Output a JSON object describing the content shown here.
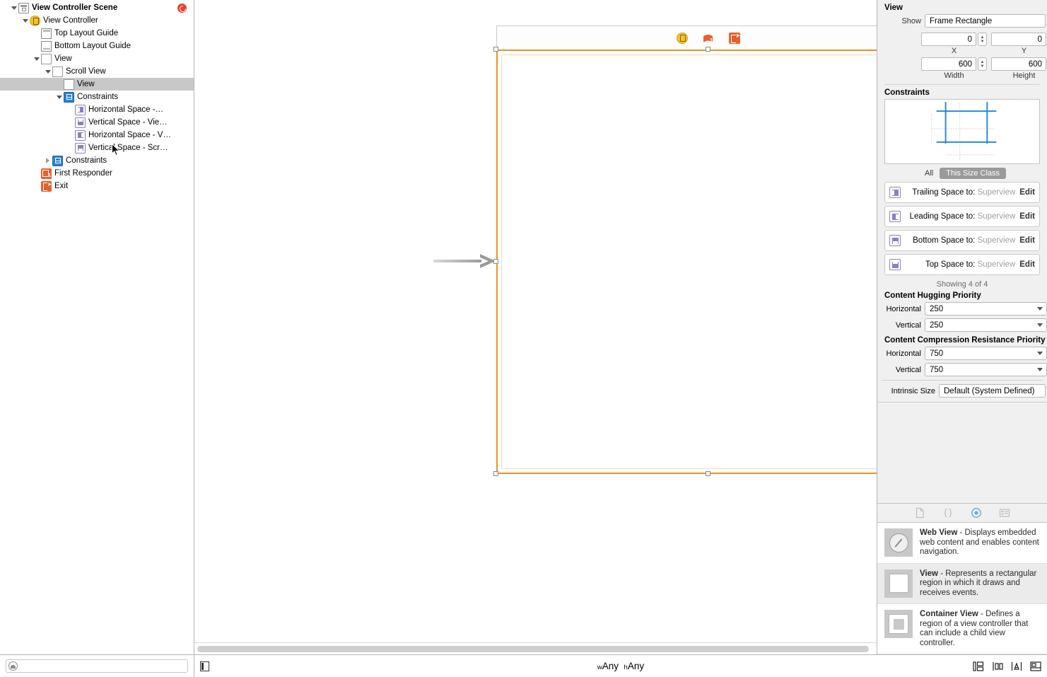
{
  "outline": {
    "rows": [
      {
        "label": "View Controller Scene",
        "indent": 0,
        "disc": "open",
        "icon": "scene-icon",
        "bold": true,
        "selected": false
      },
      {
        "label": "View Controller",
        "indent": 1,
        "disc": "open",
        "icon": "view-controller-icon",
        "bold": false,
        "selected": false
      },
      {
        "label": "Top Layout Guide",
        "indent": 2,
        "disc": "none",
        "icon": "top-layout-guide-icon",
        "bold": false,
        "selected": false
      },
      {
        "label": "Bottom Layout Guide",
        "indent": 2,
        "disc": "none",
        "icon": "bottom-layout-guide-icon",
        "bold": false,
        "selected": false
      },
      {
        "label": "View",
        "indent": 2,
        "disc": "open",
        "icon": "view-icon",
        "bold": false,
        "selected": false
      },
      {
        "label": "Scroll View",
        "indent": 3,
        "disc": "open",
        "icon": "scroll-view-icon",
        "bold": false,
        "selected": false
      },
      {
        "label": "View",
        "indent": 4,
        "disc": "none",
        "icon": "view-icon",
        "bold": false,
        "selected": true
      },
      {
        "label": "Constraints",
        "indent": 4,
        "disc": "open",
        "icon": "constraints-icon",
        "bold": false,
        "selected": false
      },
      {
        "label": "Horizontal Space -…",
        "indent": 5,
        "disc": "none",
        "icon": "constraint-h1-icon",
        "bold": false,
        "selected": false
      },
      {
        "label": "Vertical Space - Vie…",
        "indent": 5,
        "disc": "none",
        "icon": "constraint-v1-icon",
        "bold": false,
        "selected": false
      },
      {
        "label": "Horizontal Space - V…",
        "indent": 5,
        "disc": "none",
        "icon": "constraint-h2-icon",
        "bold": false,
        "selected": false
      },
      {
        "label": "Vertical Space - Scr…",
        "indent": 5,
        "disc": "none",
        "icon": "constraint-v2-icon",
        "bold": false,
        "selected": false
      },
      {
        "label": "Constraints",
        "indent": 3,
        "disc": "closed",
        "icon": "constraints-icon",
        "bold": false,
        "selected": false
      },
      {
        "label": "First Responder",
        "indent": 2,
        "disc": "none",
        "icon": "first-responder-icon",
        "bold": false,
        "selected": false
      },
      {
        "label": "Exit",
        "indent": 2,
        "disc": "none",
        "icon": "exit-icon",
        "bold": false,
        "selected": false
      }
    ],
    "error_badge": "scene-error-badge",
    "filter_placeholder": ""
  },
  "canvas": {
    "scene_bar_icons": [
      "view-controller-icon",
      "first-responder-icon",
      "exit-icon"
    ],
    "selection_color": "#e8952a",
    "entry_arrow": "storyboard-entry-point-arrow"
  },
  "inspector": {
    "title": "View",
    "show_label": "Show",
    "show_value": "Frame Rectangle",
    "frame": {
      "x_label": "X",
      "x_value": "0",
      "y_label": "Y",
      "y_value": "0",
      "width_label": "Width",
      "width_value": "600",
      "height_label": "Height",
      "height_value": "600"
    },
    "constraints_title": "Constraints",
    "scope": {
      "all": "All",
      "this_size_class": "This Size Class",
      "active": "This Size Class"
    },
    "constraint_rows": [
      {
        "label": "Trailing Space to:",
        "target": "Superview",
        "edit": "Edit",
        "icon": "constraint-trailing-icon"
      },
      {
        "label": "Leading Space to:",
        "target": "Superview",
        "edit": "Edit",
        "icon": "constraint-leading-icon"
      },
      {
        "label": "Bottom Space to:",
        "target": "Superview",
        "edit": "Edit",
        "icon": "constraint-bottom-icon"
      },
      {
        "label": "Top Space to:",
        "target": "Superview",
        "edit": "Edit",
        "icon": "constraint-top-icon"
      }
    ],
    "showing": "Showing 4 of 4",
    "hugging": {
      "title": "Content Hugging Priority",
      "horizontal_label": "Horizontal",
      "horizontal_value": "250",
      "vertical_label": "Vertical",
      "vertical_value": "250"
    },
    "compression": {
      "title": "Content Compression Resistance Priority",
      "horizontal_label": "Horizontal",
      "horizontal_value": "750",
      "vertical_label": "Vertical",
      "vertical_value": "750"
    },
    "intrinsic": {
      "label": "Intrinsic Size",
      "value": "Default (System Defined)"
    }
  },
  "library": {
    "tabs": [
      {
        "name": "file-template-library-tab",
        "active": false
      },
      {
        "name": "code-snippet-library-tab",
        "active": false
      },
      {
        "name": "object-library-tab",
        "active": true
      },
      {
        "name": "media-library-tab",
        "active": false
      }
    ],
    "items": [
      {
        "title": "Web View",
        "desc": " - Displays embedded web content and enables content navigation.",
        "icon": "web-view-icon",
        "selected": false
      },
      {
        "title": "View",
        "desc": " - Represents a rectangular region in which it draws and receives events.",
        "icon": "view-icon",
        "selected": true
      },
      {
        "title": "Container View",
        "desc": " - Defines a region of a view controller that can include a child view controller.",
        "icon": "container-view-icon",
        "selected": false
      }
    ]
  },
  "bottom_bar": {
    "document_outline_toggle": "document-outline-toggle",
    "size_class_w_prefix": "w",
    "size_class_w": "Any",
    "size_class_h_prefix": "h",
    "size_class_h": "Any",
    "tools": [
      {
        "name": "stack-button"
      },
      {
        "name": "align-button"
      },
      {
        "name": "pin-button"
      },
      {
        "name": "resolve-auto-layout-issues-button"
      }
    ]
  }
}
